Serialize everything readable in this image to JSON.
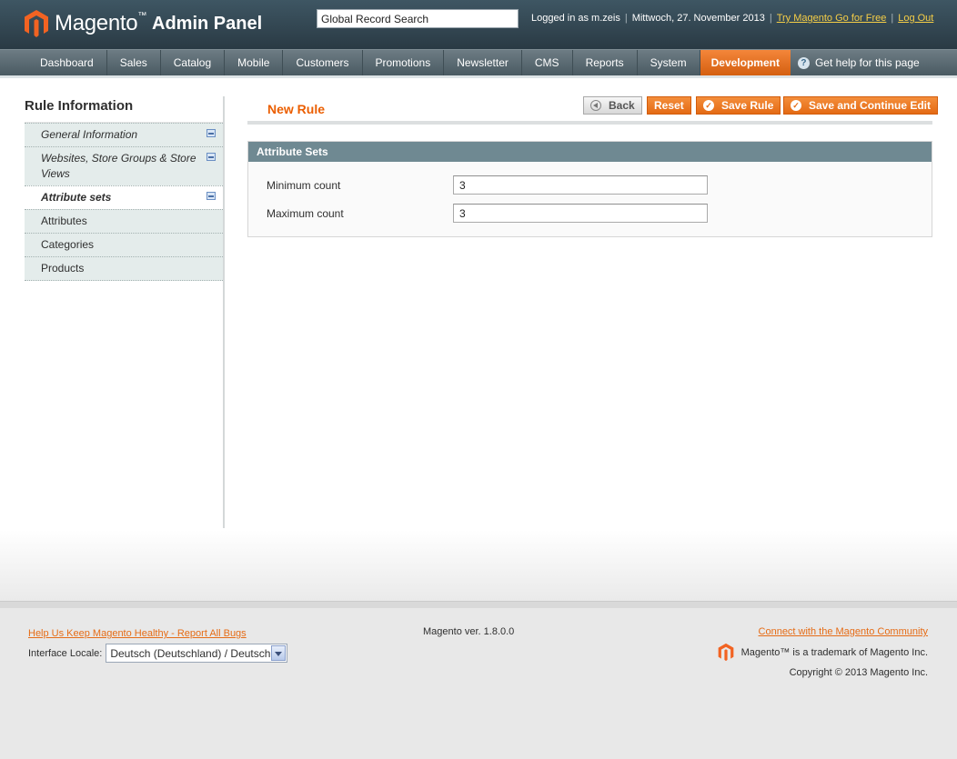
{
  "header": {
    "brand": "Magento",
    "brand_sub": "Admin Panel",
    "search_value": "Global Record Search",
    "logged_in": "Logged in as m.zeis",
    "date": "Mittwoch, 27. November 2013",
    "try_link": "Try Magento Go for Free",
    "logout": "Log Out"
  },
  "nav": {
    "items": [
      "Dashboard",
      "Sales",
      "Catalog",
      "Mobile",
      "Customers",
      "Promotions",
      "Newsletter",
      "CMS",
      "Reports",
      "System",
      "Development"
    ],
    "active": "Development",
    "help": "Get help for this page"
  },
  "sidebar": {
    "title": "Rule Information",
    "tabs": [
      {
        "label": "General Information"
      },
      {
        "label": "Websites, Store Groups & Store Views"
      },
      {
        "label": "Attribute sets"
      },
      {
        "label": "Attributes"
      },
      {
        "label": "Categories"
      },
      {
        "label": "Products"
      }
    ]
  },
  "page": {
    "title": "New Rule",
    "buttons": {
      "back": "Back",
      "reset": "Reset",
      "save": "Save Rule",
      "save_continue": "Save and Continue Edit"
    }
  },
  "fieldset": {
    "title": "Attribute Sets",
    "min_label": "Minimum count",
    "min_value": "3",
    "max_label": "Maximum count",
    "max_value": "3"
  },
  "footer": {
    "bug_link": "Help Us Keep Magento Healthy - Report All Bugs",
    "locale_label": "Interface Locale:",
    "locale_value": "Deutsch (Deutschland) / Deutsch",
    "version": "Magento ver. 1.8.0.0",
    "community_link": "Connect with the Magento Community",
    "trademark": "Magento™ is a trademark of Magento Inc.",
    "copyright": "Copyright © 2013 Magento Inc."
  },
  "colors": {
    "accent": "#eb5e00",
    "header_bg": "#2f424c",
    "fieldset_head": "#6f8992"
  }
}
